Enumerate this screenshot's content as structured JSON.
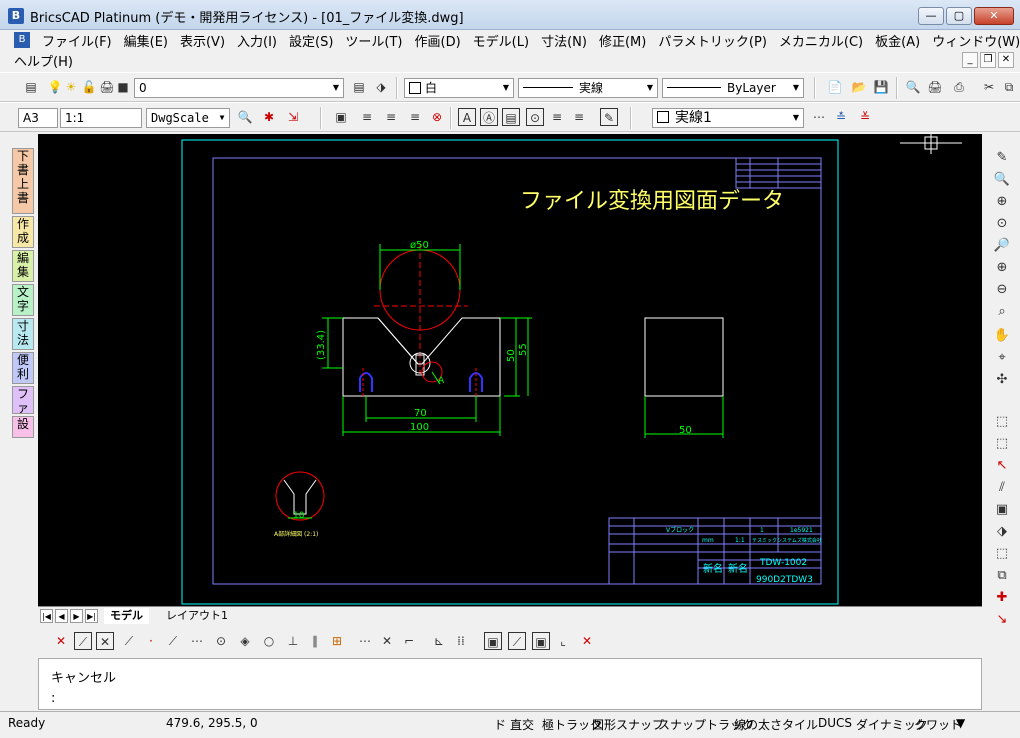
{
  "window": {
    "title": "BricsCAD Platinum (デモ・開発用ライセンス) - [01_ファイル変換.dwg]",
    "min": "—",
    "max": "▢",
    "close": "✕"
  },
  "menu": {
    "row1": [
      "ファイル(F)",
      "編集(E)",
      "表示(V)",
      "入力(I)",
      "設定(S)",
      "ツール(T)",
      "作画(D)",
      "モデル(L)",
      "寸法(N)",
      "修正(M)",
      "パラメトリック(P)",
      "メカニカル(C)",
      "板金(A)",
      "ウィンドウ(W)"
    ],
    "row2": [
      "ヘルプ(H)"
    ]
  },
  "toolbar1": {
    "layer": "0",
    "color": "白",
    "linetype": "実線",
    "lineweight": "ByLayer"
  },
  "toolbar2": {
    "paper": "A3",
    "scale": "1:1",
    "dwgscale": "DwgScale",
    "textstyle": "実線1"
  },
  "left_palette": [
    "下書",
    "上書",
    "作成",
    "編集",
    "文字",
    "寸法",
    "便利",
    "ファ",
    "設"
  ],
  "drawing": {
    "title_text": "ファイル変換用図面データ",
    "dim_phi50": "ø50",
    "dim_334": "(33.4)",
    "dim_50": "50",
    "dim_55": "55",
    "dim_70": "70",
    "dim_100": "100",
    "dim_50b": "50",
    "dim_10": "10",
    "label_a": "A",
    "detail_label": "A部詳細図 (2:1)",
    "tb_partno": "1e5921",
    "tb_name": "Vブロック",
    "tb_drawing_no": "TDW-1002",
    "tb_file": "990D2TDW3",
    "tb_company": "テスミックシステムズ株式会社",
    "tb_scale": "1:1",
    "tb_unit": "mm",
    "tb_sign1": "新名",
    "tb_sign2": "新名",
    "tb_qty": "1"
  },
  "tabs": {
    "model": "モデル",
    "layout1": "レイアウト1"
  },
  "command": {
    "line1": "キャンセル",
    "line2": ":"
  },
  "status": {
    "ready": "Ready",
    "coords": "479.6, 295.5, 0",
    "items": [
      "ド",
      "直交",
      "極トラック",
      "図形スナップ",
      "スナップトラック",
      "線の太さ",
      "タイル",
      "DUCS",
      "ダイナミック",
      "クワッド"
    ]
  },
  "colors": {
    "canvas_bg": "#000000",
    "frame_cyan": "#00ffff",
    "border_purple": "#7f7fff",
    "title_yellow": "#ffff66",
    "dim_green": "#00ff00",
    "circle_red": "#ff0000",
    "slot_blue": "#3333ff",
    "part_white": "#ffffff"
  }
}
